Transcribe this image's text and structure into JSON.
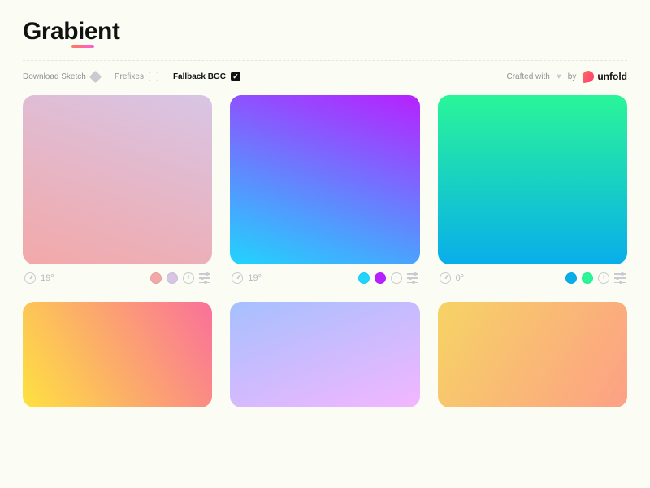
{
  "brand": {
    "title": "Grabient"
  },
  "toolbar": {
    "download_sketch": "Download Sketch",
    "prefixes_label": "Prefixes",
    "prefixes_checked": false,
    "fallback_label": "Fallback BGC",
    "fallback_checked": true,
    "crafted_with": "Crafted with",
    "by": "by",
    "partner": "unfold"
  },
  "cards": [
    {
      "angle_label": "19°",
      "gradient_css": "linear-gradient(19deg, #f3a8a8 0%, #d8c5e6 100%)",
      "stops": [
        "#f3a8a8",
        "#d8c5e6"
      ]
    },
    {
      "angle_label": "19°",
      "gradient_css": "linear-gradient(19deg, #21d4fd 0%, #b721ff 100%)",
      "stops": [
        "#21d4fd",
        "#b721ff"
      ]
    },
    {
      "angle_label": "0°",
      "gradient_css": "linear-gradient(0deg, #08aeea 0%, #2af598 100%)",
      "stops": [
        "#08aeea",
        "#2af598"
      ]
    },
    {
      "angle_label": "",
      "gradient_css": "linear-gradient(60deg, #fee140 0%, #fa709a 100%)",
      "stops": [
        "#fee140",
        "#fa709a"
      ]
    },
    {
      "angle_label": "",
      "gradient_css": "linear-gradient(160deg, #a6c0fe 0%, #f3b6ff 100%)",
      "stops": [
        "#a6c0fe",
        "#f3b6ff"
      ]
    },
    {
      "angle_label": "",
      "gradient_css": "linear-gradient(120deg, #f6d365 0%, #fda085 100%)",
      "stops": [
        "#f6d365",
        "#fda085"
      ]
    }
  ]
}
